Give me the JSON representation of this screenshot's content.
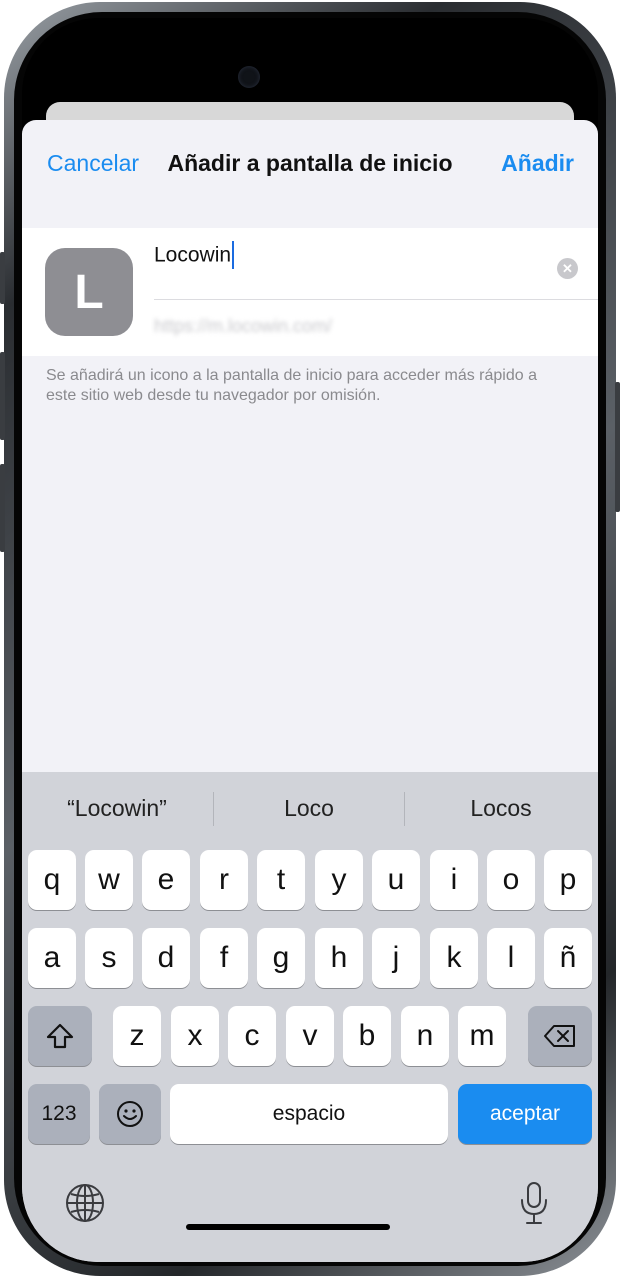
{
  "nav": {
    "cancel_label": "Cancelar",
    "title": "Añadir a pantalla de inicio",
    "add_label": "Añadir"
  },
  "bookmark": {
    "icon_letter": "L",
    "name_value": "Locowin",
    "url_value": "https://m.locowin.com/"
  },
  "help_text": "Se añadirá un icono a la pantalla de inicio para acceder más rápido a este sitio web desde tu navegador por omisión.",
  "keyboard": {
    "suggestions": [
      "“Locowin”",
      "Loco",
      "Locos"
    ],
    "row1": [
      "q",
      "w",
      "e",
      "r",
      "t",
      "y",
      "u",
      "i",
      "o",
      "p"
    ],
    "row2": [
      "a",
      "s",
      "d",
      "f",
      "g",
      "h",
      "j",
      "k",
      "l",
      "ñ"
    ],
    "row3": [
      "z",
      "x",
      "c",
      "v",
      "b",
      "n",
      "m"
    ],
    "numbers_label": "123",
    "space_label": "espacio",
    "return_label": "aceptar"
  },
  "colors": {
    "accent": "#1a8cf0",
    "sheet_bg": "#f2f2f7",
    "keyboard_bg": "#d1d3d9"
  }
}
